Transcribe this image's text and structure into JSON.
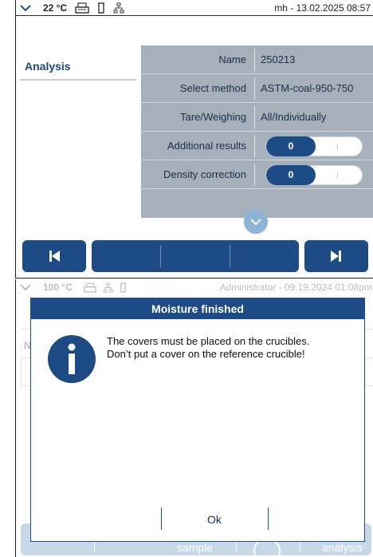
{
  "panel1": {
    "statusbar": {
      "temperature": "22 °C",
      "icons": [
        "chevron-down-icon",
        "balance-icon",
        "crucible-icon",
        "network-icon"
      ],
      "user_date": "mh - 13.02.2025 08:57"
    },
    "section_label": "Analysis",
    "rows": [
      {
        "label": "Name",
        "value": "250213"
      },
      {
        "label": "Select method",
        "value": "ASTM-coal-950-750"
      },
      {
        "label": "Tare/Weighing",
        "value": "All/Individually"
      },
      {
        "label": "Additional results",
        "toggle_value": "0"
      },
      {
        "label": "Density correction",
        "toggle_value": "0"
      }
    ],
    "nav": {
      "first_icon": "skip-back-icon",
      "last_icon": "skip-forward-icon"
    },
    "colors": {
      "accent": "#1e4a86",
      "grid": "#a5b0bb"
    }
  },
  "panel2": {
    "statusbar": {
      "temperature": "100 °C",
      "user_date": "Administrator - 09.19.2024 01:08pm"
    },
    "background": {
      "col_initial": "N",
      "bottom_label_1": "sample",
      "bottom_label_2": "analysis"
    },
    "dialog": {
      "title": "Moisture finished",
      "icon": "info-icon",
      "message_line1": "The covers must be placed on the crucibles.",
      "message_line2": "Don’t put a cover on the reference crucible!",
      "ok_label": "Ok"
    }
  }
}
